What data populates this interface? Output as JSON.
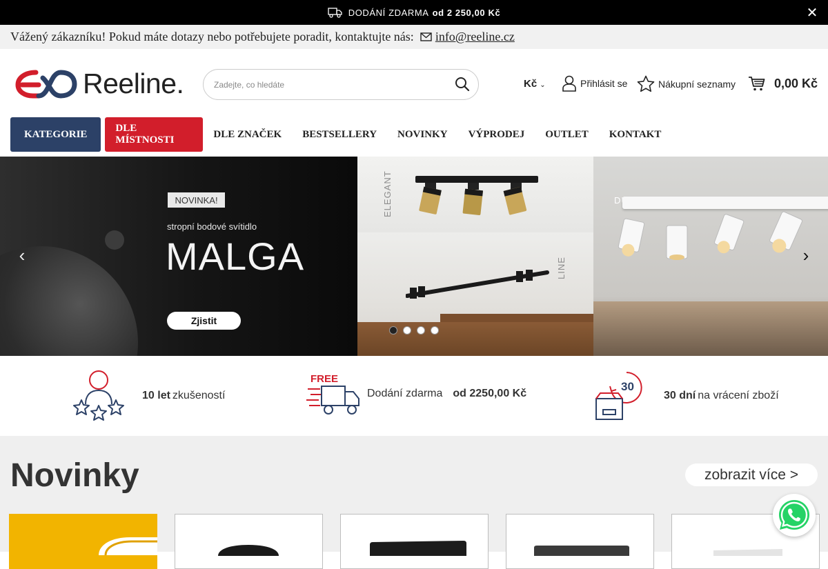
{
  "promo": {
    "text": "DODÁNÍ ZDARMA",
    "strong": "od 2 250,00 Kč",
    "close_label": "✕"
  },
  "infoline": {
    "text": "Vážený zákazníku! Pokud máte dotazy nebo potřebujete poradit, kontaktujte nás:",
    "email": "info@reeline.cz"
  },
  "header": {
    "logo_text": "Reeline.",
    "search_placeholder": "Zadejte, co hledáte",
    "currency": "Kč",
    "login": "Přihlásit se",
    "wishlist": "Nákupní seznamy",
    "cart_total": "0,00 Kč"
  },
  "nav": {
    "items": [
      "KATEGORIE",
      "DLE MÍSTNOSTI",
      "DLE ZNAČEK",
      "BESTSELLERY",
      "NOVINKY",
      "VÝPRODEJ",
      "OUTLET",
      "KONTAKT"
    ]
  },
  "hero": {
    "badge": "NOVINKA!",
    "subtitle": "stropní bodové svítidlo",
    "title": "MALGA",
    "cta": "Zjistit",
    "label_elegant": "ELEGANT",
    "label_line": "LINE",
    "label_duo": "DUO",
    "arrow_left": "‹",
    "arrow_right": "›",
    "slide_count": 4,
    "active_slide": 1
  },
  "usp": {
    "item1_strong": "10 let",
    "item1_text": "zkušeností",
    "item2_text": "Dodání zdarma",
    "item2_strong": "od 2250,00 Kč",
    "item3_strong": "30 dní",
    "item3_text": "na vrácení zboží",
    "free_label": "FREE",
    "days_label": "30"
  },
  "section": {
    "title": "Novinky",
    "more": "zobrazit více >"
  },
  "colors": {
    "nav_blue": "#2c4167",
    "nav_red": "#d21e2b",
    "brand_red": "#d21e2b",
    "brand_blue": "#2c4167"
  }
}
